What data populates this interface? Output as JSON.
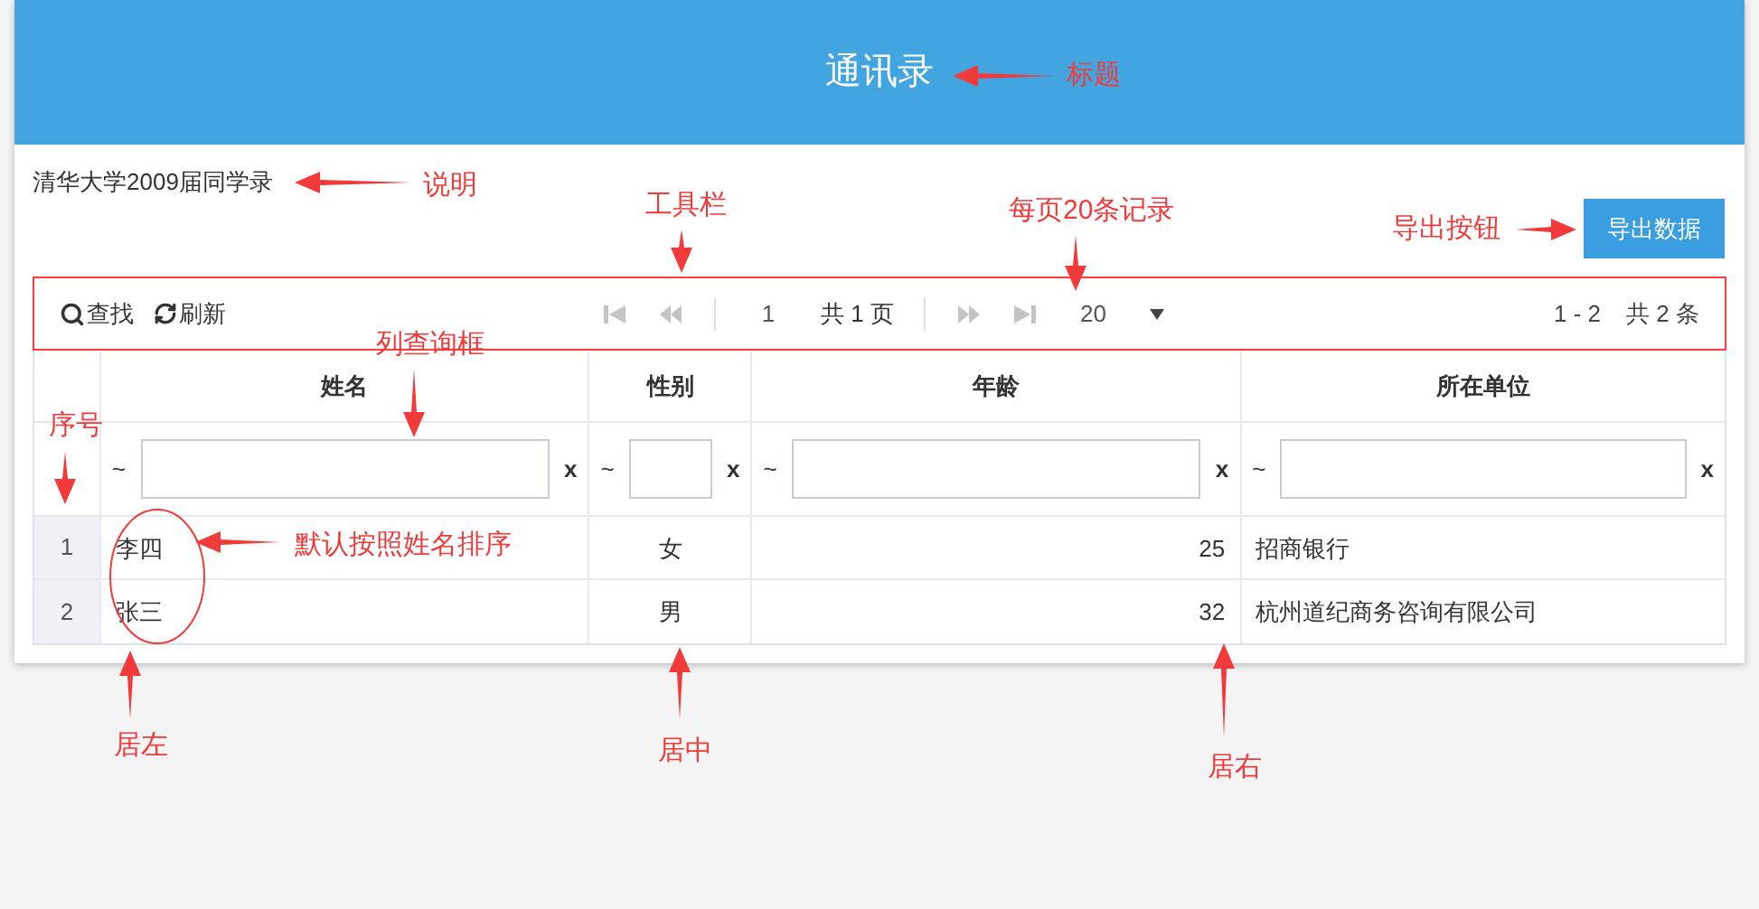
{
  "title": "通讯录",
  "description": "清华大学2009届同学录",
  "export_button": "导出数据",
  "toolbar": {
    "search_button": "查找",
    "refresh_button": "刷新",
    "page_value": "1",
    "page_total": "共 1 页",
    "page_size": "20",
    "range": "1 - 2",
    "total": "共 2 条"
  },
  "table": {
    "columns": [
      {
        "label": "姓名",
        "kind": "left",
        "filter_prefix": "~",
        "filter_clear": "x"
      },
      {
        "label": "性别",
        "kind": "center",
        "filter_prefix": "~",
        "filter_clear": "x"
      },
      {
        "label": "年龄",
        "kind": "right",
        "filter_prefix": "~",
        "filter_clear": "x"
      },
      {
        "label": "所在单位",
        "kind": "left",
        "filter_prefix": "~",
        "filter_clear": "x"
      }
    ],
    "rows": [
      {
        "index": "1",
        "cells": [
          "李四",
          "女",
          "25",
          "招商银行"
        ]
      },
      {
        "index": "2",
        "cells": [
          "张三",
          "男",
          "32",
          "杭州道纪商务咨询有限公司"
        ]
      }
    ]
  },
  "annotations": [
    "标题",
    "说明",
    "工具栏",
    "每页20条记录",
    "导出按钮",
    "列查询框",
    "序号",
    "默认按照姓名排序",
    "居左",
    "居中",
    "居右"
  ]
}
